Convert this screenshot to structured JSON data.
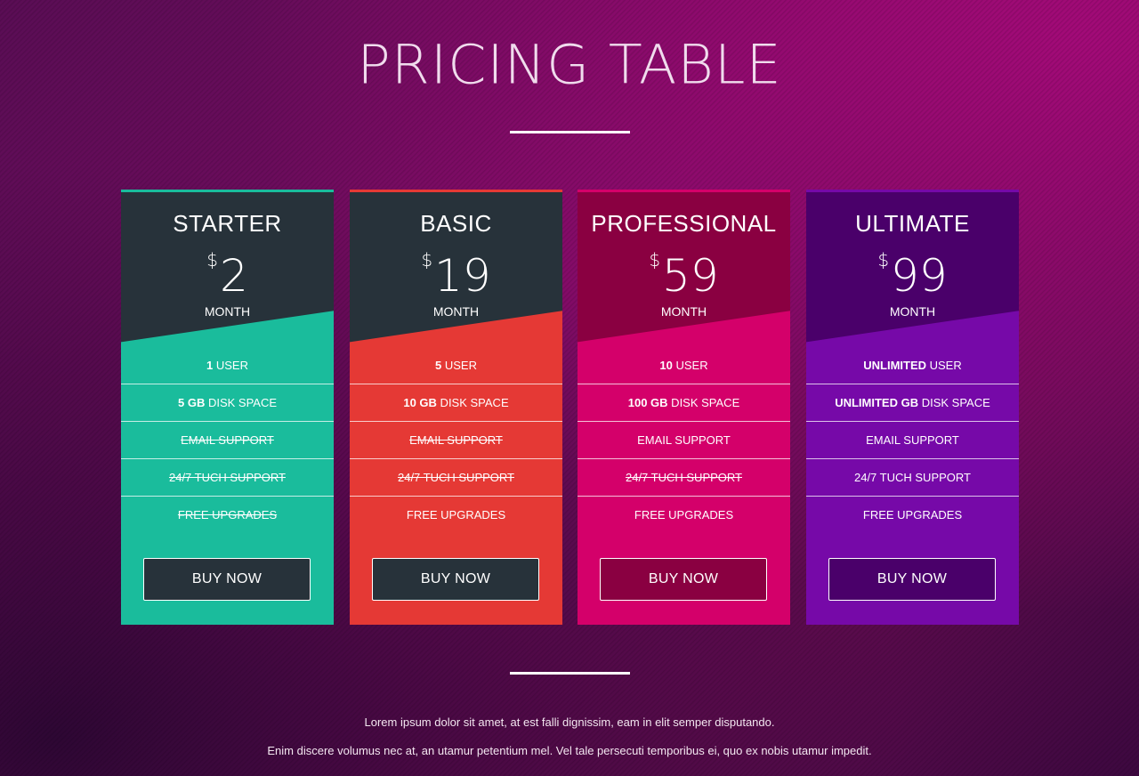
{
  "header": {
    "title": "PRICING TABLE"
  },
  "plans": [
    {
      "name": "STARTER",
      "currency": "$",
      "price": "2",
      "period": "MONTH",
      "colors": {
        "accent": "#1abc9c",
        "head": "#27323a",
        "button": "#27323a"
      },
      "features": [
        {
          "bold": "1",
          "text": " USER",
          "included": true
        },
        {
          "bold": "5 GB",
          "text": " DISK SPACE",
          "included": true
        },
        {
          "bold": "",
          "text": "EMAIL SUPPORT",
          "included": false
        },
        {
          "bold": "",
          "text": "24/7 TUCH SUPPORT",
          "included": false
        },
        {
          "bold": "",
          "text": "FREE UPGRADES",
          "included": false
        }
      ],
      "button_label": "BUY NOW"
    },
    {
      "name": "BASIC",
      "currency": "$",
      "price": "19",
      "period": "MONTH",
      "colors": {
        "accent": "#e53935",
        "head": "#27323a",
        "button": "#27323a"
      },
      "features": [
        {
          "bold": "5",
          "text": " USER",
          "included": true
        },
        {
          "bold": "10 GB",
          "text": " DISK SPACE",
          "included": true
        },
        {
          "bold": "",
          "text": "EMAIL SUPPORT",
          "included": false
        },
        {
          "bold": "",
          "text": "24/7 TUCH SUPPORT",
          "included": false
        },
        {
          "bold": "",
          "text": "FREE UPGRADES",
          "included": true
        }
      ],
      "button_label": "BUY NOW"
    },
    {
      "name": "PROFESSIONAL",
      "currency": "$",
      "price": "59",
      "period": "MONTH",
      "colors": {
        "accent": "#d4006a",
        "head": "#8a0041",
        "button": "#8a0041"
      },
      "features": [
        {
          "bold": "10",
          "text": " USER",
          "included": true
        },
        {
          "bold": "100 GB",
          "text": " DISK SPACE",
          "included": true
        },
        {
          "bold": "",
          "text": "EMAIL SUPPORT",
          "included": true
        },
        {
          "bold": "",
          "text": "24/7 TUCH SUPPORT",
          "included": false
        },
        {
          "bold": "",
          "text": "FREE UPGRADES",
          "included": true
        }
      ],
      "button_label": "BUY NOW"
    },
    {
      "name": "ULTIMATE",
      "currency": "$",
      "price": "99",
      "period": "MONTH",
      "colors": {
        "accent": "#7609a8",
        "head": "#4a006a",
        "button": "#4a006a"
      },
      "features": [
        {
          "bold": "UNLIMITED",
          "text": " USER",
          "included": true
        },
        {
          "bold": "UNLIMITED GB",
          "text": " DISK SPACE",
          "included": true
        },
        {
          "bold": "",
          "text": "EMAIL SUPPORT",
          "included": true
        },
        {
          "bold": "",
          "text": "24/7 TUCH SUPPORT",
          "included": true
        },
        {
          "bold": "",
          "text": "FREE UPGRADES",
          "included": true
        }
      ],
      "button_label": "BUY NOW"
    }
  ],
  "footer": {
    "line1": "Lorem ipsum dolor sit amet, at est falli dignissim, eam in elit semper disputando.",
    "line2": "Enim discere volumus nec at, an utamur petentium mel. Vel tale persecuti temporibus ei, quo ex nobis utamur impedit."
  }
}
